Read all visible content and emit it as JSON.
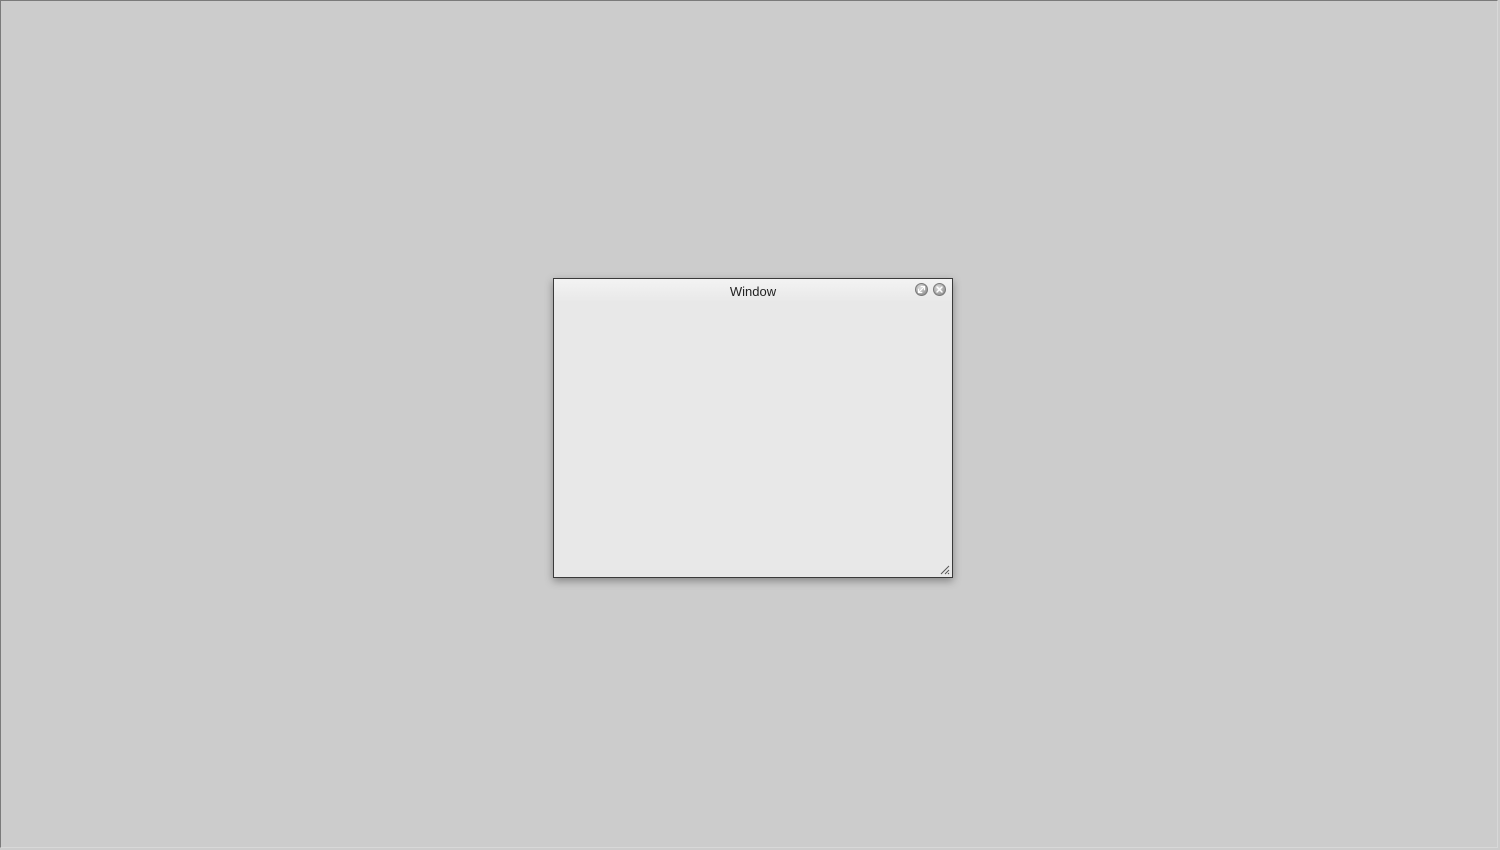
{
  "window": {
    "title": "Window",
    "controls": {
      "maximize_icon": "maximize-icon",
      "close_icon": "close-icon"
    },
    "resize_icon": "resize-grip-icon"
  },
  "colors": {
    "desktop_background": "#cccccc",
    "window_background": "#e8e8e8",
    "window_border": "#3a3a3a",
    "title_text": "#222222"
  }
}
